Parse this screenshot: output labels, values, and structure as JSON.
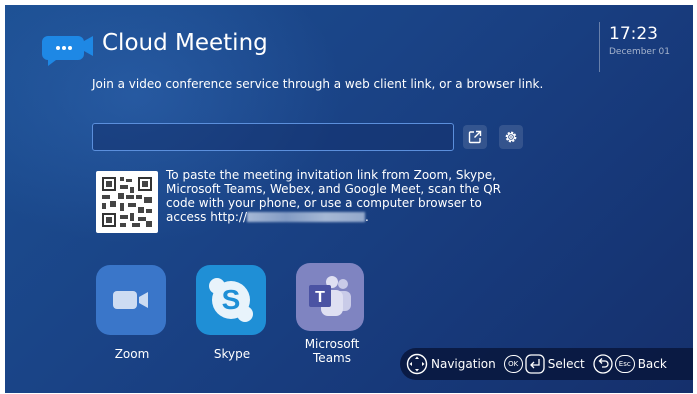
{
  "header": {
    "title": "Cloud Meeting",
    "time": "17:23",
    "date": "December 01"
  },
  "main": {
    "description": "Join a video conference service through a web client link, or a browser link.",
    "url_input": {
      "value": "",
      "placeholder": ""
    },
    "qr_instruction_prefix": "To paste the meeting invitation link from Zoom, Skype, Microsoft Teams, Webex, and Google Meet, scan the QR code with your phone, or use a computer browser to access http://",
    "qr_instruction_suffix": "."
  },
  "apps": [
    {
      "label": "Zoom",
      "icon": "zoom-icon",
      "color": "#3a76c9"
    },
    {
      "label": "Skype",
      "icon": "skype-icon",
      "color": "#1f8fd6"
    },
    {
      "label": "Microsoft Teams",
      "icon": "teams-icon",
      "color": "#5b62ae"
    }
  ],
  "hints": {
    "navigation": "Navigation",
    "ok_key": "OK",
    "select": "Select",
    "esc_key": "Esc",
    "back": "Back"
  },
  "colors": {
    "background": "#1a4386",
    "accent": "#5b8fdc",
    "logo": "#1e88e5"
  }
}
